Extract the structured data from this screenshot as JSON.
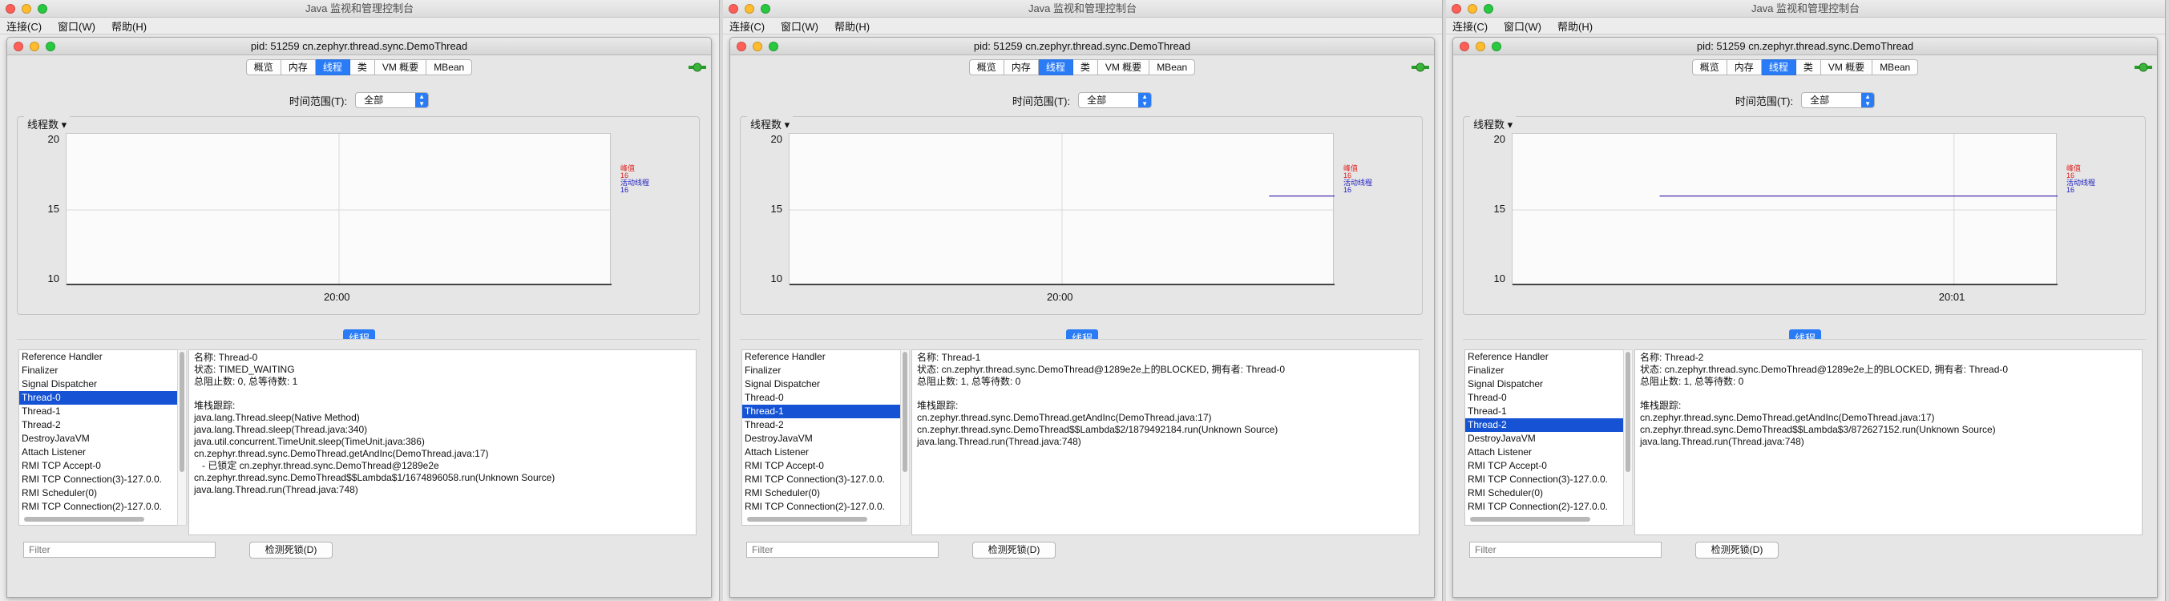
{
  "app_title": "Java 监视和管理控制台",
  "menu": [
    "连接(C)",
    "窗口(W)",
    "帮助(H)"
  ],
  "inner_title": "pid: 51259 cn.zephyr.thread.sync.DemoThread",
  "tabs": [
    "概览",
    "内存",
    "线程",
    "类",
    "VM 概要",
    "MBean"
  ],
  "active_tab": "线程",
  "time_range_label": "时间范围(T):",
  "time_range_value": "全部",
  "chart_label": "线程数",
  "thread_section_label": "线程",
  "filter_placeholder": "Filter",
  "deadlock_button": "检测死锁(D)",
  "colors": {
    "accent": "#2a7cf6",
    "selected": "#1553d4",
    "peak": "#e02020",
    "live": "#2020c0"
  },
  "panels": [
    {
      "chart_data": {
        "type": "line",
        "ylabel": "线程数",
        "y_ticks": [
          "20",
          "15",
          "10"
        ],
        "ylim": [
          10,
          20
        ],
        "x_ticks": [
          "20:00"
        ],
        "series": [
          {
            "name": "峰值",
            "value": "16",
            "points": []
          },
          {
            "name": "活动线程",
            "value": "16",
            "points": []
          }
        ]
      },
      "selected_index": 3,
      "threads": [
        "Reference Handler",
        "Finalizer",
        "Signal Dispatcher",
        "Thread-0",
        "Thread-1",
        "Thread-2",
        "DestroyJavaVM",
        "Attach Listener",
        "RMI TCP Accept-0",
        "RMI TCP Connection(3)-127.0.0.",
        "RMI Scheduler(0)",
        "RMI TCP Connection(2)-127.0.0."
      ],
      "detail": "名称: Thread-0\n状态: TIMED_WAITING\n总阻止数: 0, 总等待数: 1\n\n堆栈跟踪:\njava.lang.Thread.sleep(Native Method)\njava.lang.Thread.sleep(Thread.java:340)\njava.util.concurrent.TimeUnit.sleep(TimeUnit.java:386)\ncn.zephyr.thread.sync.DemoThread.getAndInc(DemoThread.java:17)\n   - 已锁定 cn.zephyr.thread.sync.DemoThread@1289e2e\ncn.zephyr.thread.sync.DemoThread$$Lambda$1/1674896058.run(Unknown Source)\njava.lang.Thread.run(Thread.java:748)"
    },
    {
      "chart_data": {
        "type": "line",
        "ylabel": "线程数",
        "y_ticks": [
          "20",
          "15",
          "10"
        ],
        "ylim": [
          10,
          20
        ],
        "x_ticks": [
          "20:00"
        ],
        "series": [
          {
            "name": "峰值",
            "value": "16",
            "points": [
              [
                0.88,
                16
              ],
              [
                1.0,
                16
              ]
            ]
          },
          {
            "name": "活动线程",
            "value": "16",
            "points": [
              [
                0.88,
                16
              ],
              [
                1.0,
                16
              ]
            ]
          }
        ]
      },
      "selected_index": 4,
      "threads": [
        "Reference Handler",
        "Finalizer",
        "Signal Dispatcher",
        "Thread-0",
        "Thread-1",
        "Thread-2",
        "DestroyJavaVM",
        "Attach Listener",
        "RMI TCP Accept-0",
        "RMI TCP Connection(3)-127.0.0.",
        "RMI Scheduler(0)",
        "RMI TCP Connection(2)-127.0.0."
      ],
      "detail": "名称: Thread-1\n状态: cn.zephyr.thread.sync.DemoThread@1289e2e上的BLOCKED, 拥有者: Thread-0\n总阻止数: 1, 总等待数: 0\n\n堆栈跟踪:\ncn.zephyr.thread.sync.DemoThread.getAndInc(DemoThread.java:17)\ncn.zephyr.thread.sync.DemoThread$$Lambda$2/1879492184.run(Unknown Source)\njava.lang.Thread.run(Thread.java:748)"
    },
    {
      "chart_data": {
        "type": "line",
        "ylabel": "线程数",
        "y_ticks": [
          "20",
          "15",
          "10"
        ],
        "ylim": [
          10,
          20
        ],
        "x_ticks": [
          "20:01"
        ],
        "series": [
          {
            "name": "峰值",
            "value": "16",
            "points": [
              [
                0.27,
                16
              ],
              [
                1.0,
                16
              ]
            ]
          },
          {
            "name": "活动线程",
            "value": "16",
            "points": [
              [
                0.27,
                16
              ],
              [
                1.0,
                16
              ]
            ]
          }
        ]
      },
      "selected_index": 5,
      "threads": [
        "Reference Handler",
        "Finalizer",
        "Signal Dispatcher",
        "Thread-0",
        "Thread-1",
        "Thread-2",
        "DestroyJavaVM",
        "Attach Listener",
        "RMI TCP Accept-0",
        "RMI TCP Connection(3)-127.0.0.",
        "RMI Scheduler(0)",
        "RMI TCP Connection(2)-127.0.0."
      ],
      "detail": "名称: Thread-2\n状态: cn.zephyr.thread.sync.DemoThread@1289e2e上的BLOCKED, 拥有者: Thread-0\n总阻止数: 1, 总等待数: 0\n\n堆栈跟踪:\ncn.zephyr.thread.sync.DemoThread.getAndInc(DemoThread.java:17)\ncn.zephyr.thread.sync.DemoThread$$Lambda$3/872627152.run(Unknown Source)\njava.lang.Thread.run(Thread.java:748)"
    }
  ]
}
